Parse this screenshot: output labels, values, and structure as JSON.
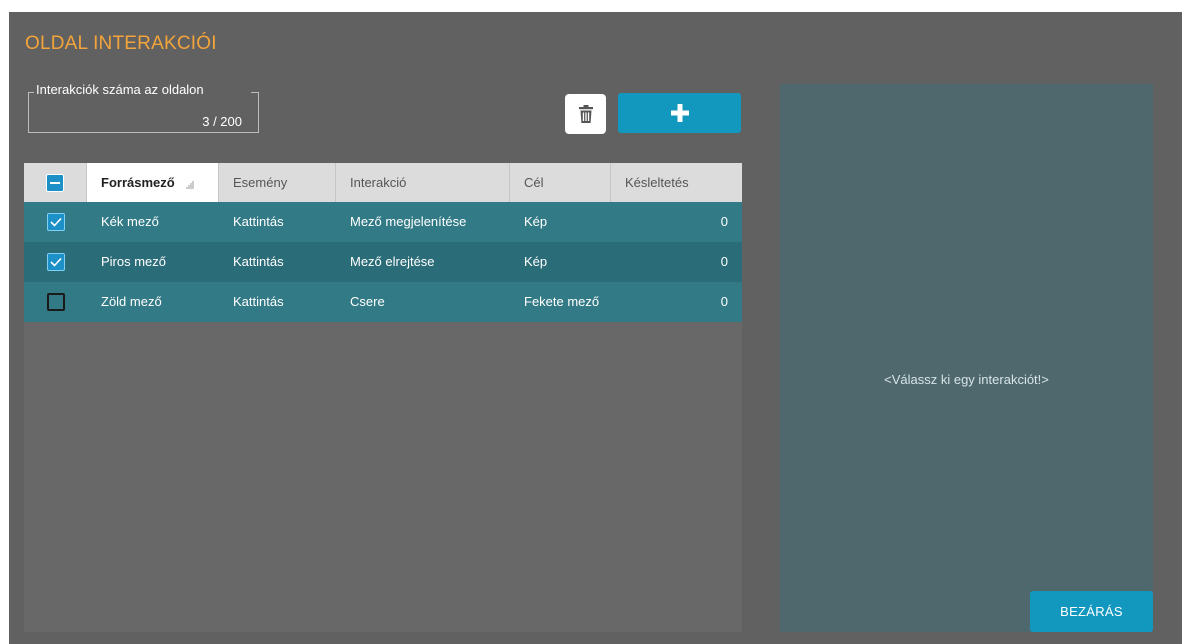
{
  "dialog": {
    "title": "OLDAL INTERAKCIÓI"
  },
  "counter": {
    "label": "Interakciók száma az oldalon",
    "value": "3 / 200"
  },
  "toolbar": {
    "delete_icon": "trash-icon",
    "add_icon": "plus-icon"
  },
  "table": {
    "columns": [
      "Forrásmező",
      "Esemény",
      "Interakció",
      "Cél",
      "Késleltetés"
    ],
    "rows": [
      {
        "checked": true,
        "source": "Kék mező",
        "event": "Kattintás",
        "interaction": "Mező megjelenítése",
        "target": "Kép",
        "delay": "0"
      },
      {
        "checked": true,
        "source": "Piros mező",
        "event": "Kattintás",
        "interaction": "Mező elrejtése",
        "target": "Kép",
        "delay": "0"
      },
      {
        "checked": false,
        "source": "Zöld mező",
        "event": "Kattintás",
        "interaction": "Csere",
        "target": "Fekete mező",
        "delay": "0"
      }
    ]
  },
  "side": {
    "placeholder": "<Válassz ki egy interakciót!>"
  },
  "footer": {
    "close_label": "BEZÁRÁS"
  },
  "colors": {
    "accent": "#1297bf",
    "title": "#f3a43a",
    "row_a": "#327a86",
    "row_b": "#2a6c78"
  }
}
